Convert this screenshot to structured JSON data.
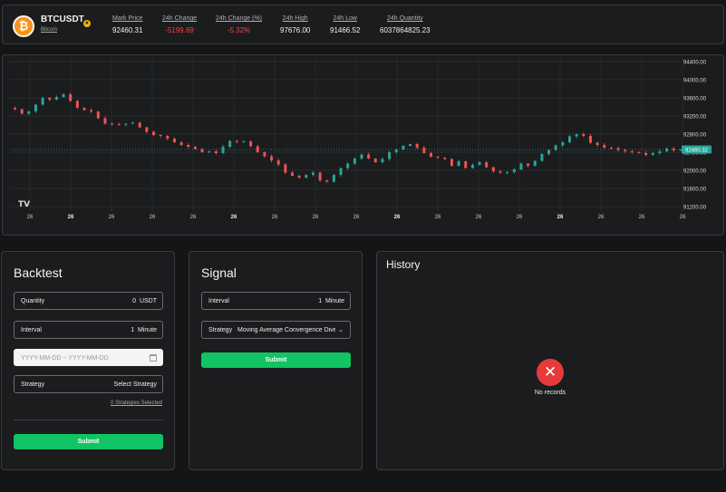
{
  "ticker": {
    "coin_icon": "bitcoin-icon",
    "coin_glyph": "₿",
    "symbol": "BTCUSDT",
    "name": "Bitcoin",
    "favorite_icon": "star-badge-icon",
    "stats": [
      {
        "label": "Mark Price",
        "value": "92460.31",
        "negative": false
      },
      {
        "label": "24h Change",
        "value": "-5199.69",
        "negative": true
      },
      {
        "label": "24h Change (%)",
        "value": "-5.32%",
        "negative": true
      },
      {
        "label": "24h High",
        "value": "97676.00",
        "negative": false
      },
      {
        "label": "24h Low",
        "value": "91466.52",
        "negative": false
      },
      {
        "label": "24h Quantity",
        "value": "6037864825.23",
        "negative": false
      }
    ]
  },
  "chart_data": {
    "type": "candlestick",
    "price_ticks": [
      "94400.00",
      "94000.00",
      "93600.00",
      "93200.00",
      "92800.00",
      "92400.00",
      "92000.00",
      "91600.00",
      "91200.00"
    ],
    "time_ticks": [
      "26",
      "26",
      "26",
      "26",
      "26",
      "26",
      "26",
      "26",
      "26",
      "26",
      "26",
      "26",
      "26",
      "26",
      "26",
      "26",
      "26"
    ],
    "bold_time_ticks": [
      1,
      5,
      9,
      13
    ],
    "last_price_label": "92460.32",
    "last_price": 92460.32,
    "ylim": [
      91100,
      94500
    ],
    "up_color": "#26a69a",
    "down_color": "#ef5350",
    "grid": true,
    "watermark": "TV",
    "path": [
      93380,
      93350,
      93250,
      93300,
      93450,
      93600,
      93560,
      93620,
      93680,
      93530,
      93380,
      93330,
      93300,
      93150,
      93030,
      93020,
      93010,
      93030,
      93050,
      92950,
      92850,
      92780,
      92760,
      92700,
      92620,
      92560,
      92520,
      92470,
      92400,
      92420,
      92380,
      92520,
      92650,
      92630,
      92640,
      92530,
      92400,
      92310,
      92220,
      92130,
      91950,
      91880,
      91840,
      91900,
      91950,
      91780,
      91750,
      91900,
      92050,
      92150,
      92260,
      92350,
      92260,
      92180,
      92250,
      92400,
      92460,
      92540,
      92580,
      92500,
      92380,
      92300,
      92280,
      92250,
      92100,
      92200,
      92050,
      92120,
      92180,
      92070,
      91980,
      91950,
      91960,
      92020,
      92150,
      92100,
      92210,
      92360,
      92450,
      92550,
      92620,
      92750,
      92800,
      92760,
      92610,
      92560,
      92500,
      92490,
      92450,
      92420,
      92400,
      92380,
      92340,
      92380,
      92420,
      92480,
      92440,
      92460
    ]
  },
  "backtest": {
    "title": "Backtest",
    "quantity_label": "Quantity",
    "quantity_value": "0",
    "quantity_unit": "USDT",
    "interval_label": "Interval",
    "interval_value": "1",
    "interval_unit": "Minute",
    "date_placeholder": "YYYY-MM-DD ~ YYYY-MM-DD",
    "strategy_label": "Strategy",
    "strategy_value": "Select Strategy",
    "strategies_note": "0 Strategies Selected",
    "submit_label": "Submit"
  },
  "signal": {
    "title": "Signal",
    "interval_label": "Interval",
    "interval_value": "1",
    "interval_unit": "Minute",
    "strategy_label": "Strategy",
    "strategy_value": "Moving Average Convergence Divergence",
    "submit_label": "Submit"
  },
  "history": {
    "title": "History",
    "empty_icon": "close-circle-icon",
    "empty_text": "No records"
  },
  "colors": {
    "accent": "#10c463",
    "negative": "#f04646",
    "empty_icon": "#e53b3b",
    "coin": "#f7931a"
  }
}
